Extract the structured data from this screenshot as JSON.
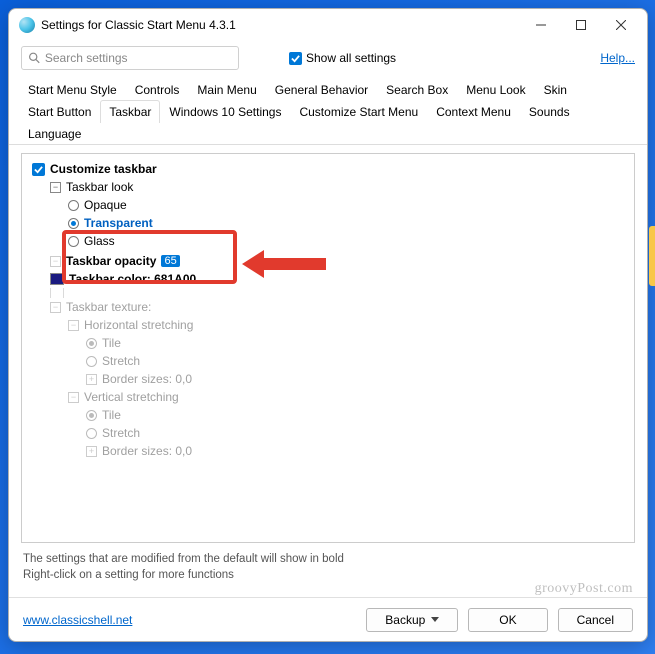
{
  "title": "Settings for Classic Start Menu 4.3.1",
  "search": {
    "placeholder": "Search settings"
  },
  "show_all_label": "Show all settings",
  "help_label": "Help...",
  "tabs": {
    "row1": [
      "Start Menu Style",
      "Controls",
      "Main Menu",
      "General Behavior",
      "Search Box",
      "Menu Look",
      "Skin"
    ],
    "row2": [
      "Start Button",
      "Taskbar",
      "Windows 10 Settings",
      "Customize Start Menu",
      "Context Menu",
      "Sounds",
      "Language"
    ],
    "active": "Taskbar"
  },
  "tree": {
    "customize_taskbar": "Customize taskbar",
    "taskbar_look": "Taskbar look",
    "look_options": {
      "opaque": "Opaque",
      "transparent": "Transparent",
      "glass": "Glass"
    },
    "opacity_label": "Taskbar opacity",
    "opacity_value": "65",
    "color_label": "Taskbar color: 681A00",
    "color_swatch": "#1a1a80",
    "text_color_label_partial": "",
    "texture_label": "Taskbar texture:",
    "hstretch": "Horizontal stretching",
    "vstretch": "Vertical stretching",
    "tile": "Tile",
    "stretch": "Stretch",
    "border": "Border sizes: 0,0"
  },
  "footer": {
    "line1": "The settings that are modified from the default will show in bold",
    "line2": "Right-click on a setting for more functions"
  },
  "watermark": "groovyPost.com",
  "url": "www.classicshell.net",
  "buttons": {
    "backup": "Backup",
    "ok": "OK",
    "cancel": "Cancel"
  }
}
